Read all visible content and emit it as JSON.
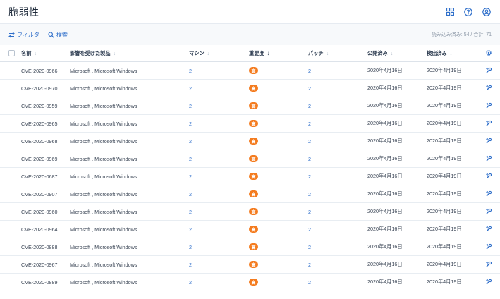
{
  "header": {
    "title": "脆弱性",
    "icons": [
      "grid-icon",
      "help-icon",
      "account-icon"
    ]
  },
  "toolbar": {
    "filter_label": "フィルタ",
    "search_label": "検索",
    "count_text": "読み込み済み: 54 / 合計: 71"
  },
  "columns": {
    "name": "名前",
    "products": "影響を受けた製品",
    "machines": "マシン",
    "severity": "重要度",
    "patches": "パッチ",
    "published": "公開済み",
    "detected": "検出済み"
  },
  "sort": {
    "inactive_arrow": "↓",
    "active_column": "severity"
  },
  "colors": {
    "accent": "#2f6fca",
    "severity_high": "#f47c20"
  },
  "rows": [
    {
      "name": "CVE-2020-0966",
      "products": "Microsoft , Microsoft Windows",
      "machines": "2",
      "severity": "高",
      "patches": "2",
      "published": "2020年4月16日",
      "detected": "2020年4月19日"
    },
    {
      "name": "CVE-2020-0970",
      "products": "Microsoft , Microsoft Windows",
      "machines": "2",
      "severity": "高",
      "patches": "2",
      "published": "2020年4月16日",
      "detected": "2020年4月19日"
    },
    {
      "name": "CVE-2020-0959",
      "products": "Microsoft , Microsoft Windows",
      "machines": "2",
      "severity": "高",
      "patches": "2",
      "published": "2020年4月16日",
      "detected": "2020年4月19日"
    },
    {
      "name": "CVE-2020-0965",
      "products": "Microsoft , Microsoft Windows",
      "machines": "2",
      "severity": "高",
      "patches": "2",
      "published": "2020年4月16日",
      "detected": "2020年4月19日"
    },
    {
      "name": "CVE-2020-0968",
      "products": "Microsoft , Microsoft Windows",
      "machines": "2",
      "severity": "高",
      "patches": "2",
      "published": "2020年4月16日",
      "detected": "2020年4月19日"
    },
    {
      "name": "CVE-2020-0969",
      "products": "Microsoft , Microsoft Windows",
      "machines": "2",
      "severity": "高",
      "patches": "2",
      "published": "2020年4月16日",
      "detected": "2020年4月19日"
    },
    {
      "name": "CVE-2020-0687",
      "products": "Microsoft , Microsoft Windows",
      "machines": "2",
      "severity": "高",
      "patches": "2",
      "published": "2020年4月16日",
      "detected": "2020年4月19日"
    },
    {
      "name": "CVE-2020-0907",
      "products": "Microsoft , Microsoft Windows",
      "machines": "2",
      "severity": "高",
      "patches": "2",
      "published": "2020年4月16日",
      "detected": "2020年4月19日"
    },
    {
      "name": "CVE-2020-0960",
      "products": "Microsoft , Microsoft Windows",
      "machines": "2",
      "severity": "高",
      "patches": "2",
      "published": "2020年4月16日",
      "detected": "2020年4月19日"
    },
    {
      "name": "CVE-2020-0964",
      "products": "Microsoft , Microsoft Windows",
      "machines": "2",
      "severity": "高",
      "patches": "2",
      "published": "2020年4月16日",
      "detected": "2020年4月19日"
    },
    {
      "name": "CVE-2020-0888",
      "products": "Microsoft , Microsoft Windows",
      "machines": "2",
      "severity": "高",
      "patches": "2",
      "published": "2020年4月16日",
      "detected": "2020年4月19日"
    },
    {
      "name": "CVE-2020-0967",
      "products": "Microsoft , Microsoft Windows",
      "machines": "2",
      "severity": "高",
      "patches": "2",
      "published": "2020年4月16日",
      "detected": "2020年4月19日"
    },
    {
      "name": "CVE-2020-0889",
      "products": "Microsoft , Microsoft Windows",
      "machines": "2",
      "severity": "高",
      "patches": "2",
      "published": "2020年4月16日",
      "detected": "2020年4月19日"
    }
  ]
}
